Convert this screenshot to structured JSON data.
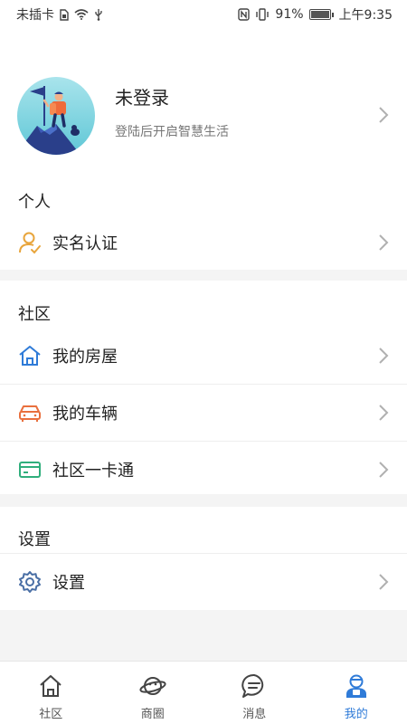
{
  "status_bar": {
    "carrier": "未插卡",
    "battery": "91%",
    "battery_level": 0.91,
    "time": "上午9:35"
  },
  "profile": {
    "name": "未登录",
    "subtitle": "登陆后开启智慧生活"
  },
  "personal": {
    "title": "个人",
    "items": [
      {
        "label": "实名认证",
        "icon": "user-verify-icon"
      }
    ]
  },
  "community": {
    "title": "社区",
    "items": [
      {
        "label": "我的房屋",
        "icon": "house-icon"
      },
      {
        "label": "我的车辆",
        "icon": "car-icon"
      },
      {
        "label": "社区一卡通",
        "icon": "card-icon"
      }
    ]
  },
  "settings": {
    "title": "设置",
    "items": [
      {
        "label": "设置",
        "icon": "gear-icon"
      }
    ]
  },
  "tabbar": {
    "active": "我的",
    "tabs": [
      {
        "label": "社区",
        "icon": "home-icon"
      },
      {
        "label": "商圈",
        "icon": "planet-icon"
      },
      {
        "label": "消息",
        "icon": "message-icon"
      },
      {
        "label": "我的",
        "icon": "person-icon"
      }
    ]
  },
  "colors": {
    "accent_blue": "#2f7bd8",
    "verify_orange": "#e8a53c",
    "car_orange": "#e9703e",
    "card_green": "#2fae7c",
    "settings_blue": "#4a6fa5"
  }
}
